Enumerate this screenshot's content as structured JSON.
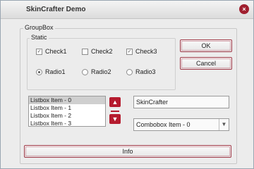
{
  "window": {
    "title": "SkinCrafter Demo"
  },
  "groupbox": {
    "label": "GroupBox"
  },
  "staticbox": {
    "label": "Static"
  },
  "checkboxes": [
    {
      "label": "Check1",
      "checked": true
    },
    {
      "label": "Check2",
      "checked": false
    },
    {
      "label": "Check3",
      "checked": true
    }
  ],
  "radios": [
    {
      "label": "Radio1",
      "selected": true
    },
    {
      "label": "Radio2",
      "selected": false
    },
    {
      "label": "Radio3",
      "selected": false
    }
  ],
  "buttons": {
    "ok": "OK",
    "cancel": "Cancel",
    "info": "Info"
  },
  "listbox": {
    "items": [
      "Listbox Item - 0",
      "Listbox Item - 1",
      "Listbox Item - 2",
      "Listbox Item - 3"
    ],
    "selected_index": 0
  },
  "edit": {
    "value": "SkinCrafter"
  },
  "combobox": {
    "value": "Combobox Item - 0"
  },
  "colors": {
    "accent": "#b51b2e",
    "background": "#ececec"
  }
}
